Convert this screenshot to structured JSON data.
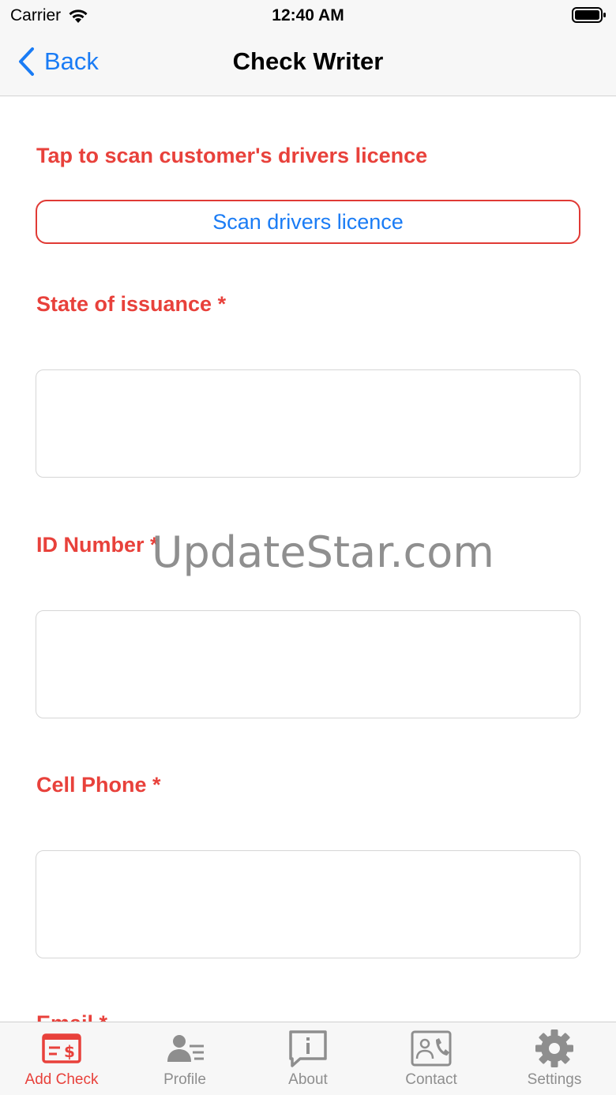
{
  "status_bar": {
    "carrier": "Carrier",
    "time": "12:40 AM"
  },
  "nav": {
    "back_label": "Back",
    "title": "Check Writer"
  },
  "form": {
    "scan_prompt": "Tap to scan customer's drivers licence",
    "scan_button": "Scan drivers licence",
    "fields": [
      {
        "label": "State of issuance *",
        "value": ""
      },
      {
        "label": "ID Number *",
        "value": ""
      },
      {
        "label": "Cell Phone *",
        "value": ""
      },
      {
        "label": "Email *",
        "value": ""
      }
    ]
  },
  "watermark": "UpdateStar.com",
  "tabs": [
    {
      "label": "Add Check",
      "icon": "check-dollar-icon",
      "active": true
    },
    {
      "label": "Profile",
      "icon": "profile-card-icon",
      "active": false
    },
    {
      "label": "About",
      "icon": "info-bubble-icon",
      "active": false
    },
    {
      "label": "Contact",
      "icon": "contact-phone-icon",
      "active": false
    },
    {
      "label": "Settings",
      "icon": "gear-icon",
      "active": false
    }
  ],
  "colors": {
    "accent": "#e8413b",
    "link": "#1a7cf5",
    "inactive": "#8e8e8e"
  }
}
